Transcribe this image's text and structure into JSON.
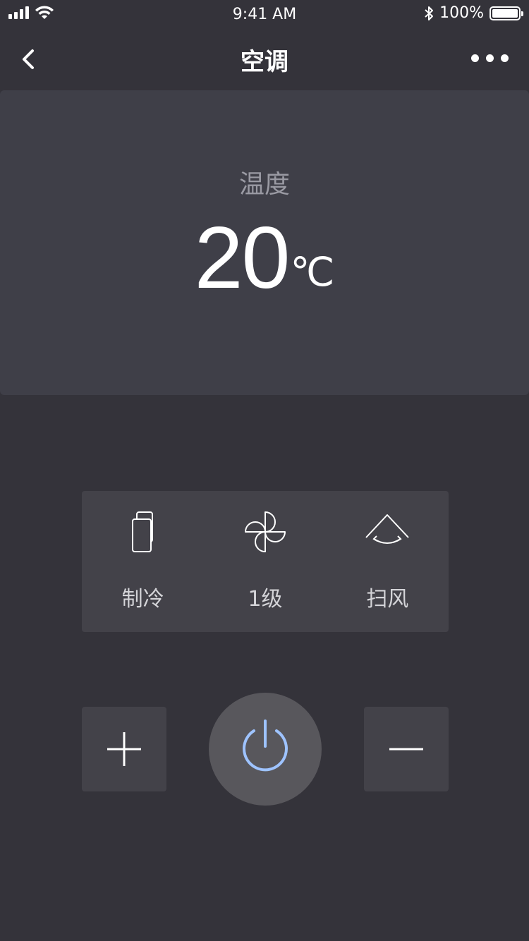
{
  "status_bar": {
    "time": "9:41 AM",
    "battery": "100%",
    "icons": [
      "signal-icon",
      "wifi-icon",
      "bluetooth-icon",
      "battery-icon"
    ]
  },
  "nav": {
    "title": "空调",
    "back_icon": "chevron-left-icon",
    "more_icon": "more-dots-icon"
  },
  "temperature": {
    "label": "温度",
    "value": "20",
    "unit": "℃"
  },
  "modes": [
    {
      "label": "制冷",
      "icon": "cooling-mode-icon"
    },
    {
      "label": "1级",
      "icon": "fan-icon"
    },
    {
      "label": "扫风",
      "icon": "swing-icon"
    }
  ],
  "controls": {
    "increase_icon": "plus-icon",
    "power_icon": "power-icon",
    "decrease_icon": "minus-icon"
  },
  "colors": {
    "background": "#34333a",
    "card": "#3f3f48",
    "panel": "#434249",
    "power_button": "#58575c",
    "power_accent": "#9ec3ff"
  }
}
